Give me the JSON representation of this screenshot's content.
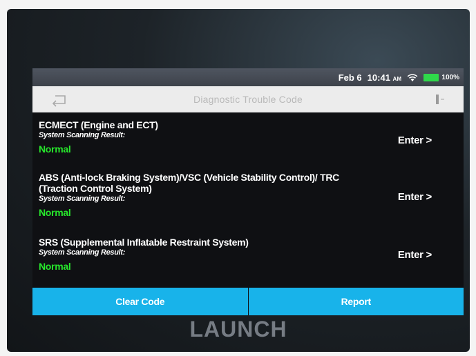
{
  "status_bar": {
    "date": "Feb 6",
    "time": "10:41",
    "time_suffix": "AM",
    "battery": "100%"
  },
  "header": {
    "title": "Diagnostic Trouble Code",
    "back_icon": "back-arrow-icon",
    "menu_icon": "menu-icon"
  },
  "systems": [
    {
      "name": "ECMECT (Engine and ECT)",
      "scan_label": "System Scanning Result:",
      "status": "Normal",
      "enter_label": "Enter >"
    },
    {
      "name": "ABS (Anti-lock Braking System)/VSC (Vehicle Stability Control)/ TRC (Traction Control System)",
      "scan_label": "System Scanning Result:",
      "status": "Normal",
      "enter_label": "Enter >"
    },
    {
      "name": "SRS (Supplemental Inflatable Restraint System)",
      "scan_label": "System Scanning Result:",
      "status": "Normal",
      "enter_label": "Enter >"
    }
  ],
  "actions": {
    "clear_code": "Clear Code",
    "report": "Report"
  },
  "brand": "LAUNCH",
  "colors": {
    "accent": "#18b3ea",
    "status_normal": "#27e72c",
    "screen_bg": "#0f1013",
    "title_bar_bg": "#ececec"
  }
}
